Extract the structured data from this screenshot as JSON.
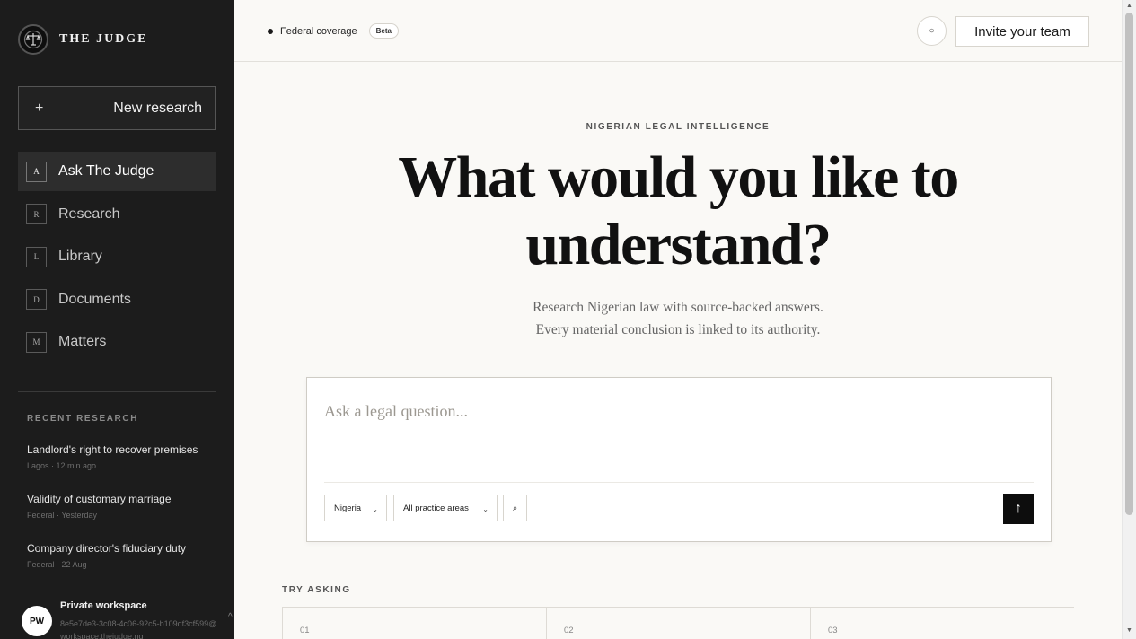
{
  "sidebar": {
    "brand": {
      "name": "THE JUDGE",
      "logo_icon": "scales-of-justice-icon"
    },
    "new_research": {
      "icon": "+",
      "label": "New research"
    },
    "nav": [
      {
        "key": "A",
        "label": "Ask The Judge",
        "active": true
      },
      {
        "key": "R",
        "label": "Research"
      },
      {
        "key": "L",
        "label": "Library"
      },
      {
        "key": "D",
        "label": "Documents"
      },
      {
        "key": "M",
        "label": "Matters"
      }
    ],
    "recent_title": "RECENT RESEARCH",
    "recent": [
      {
        "title": "Landlord's right to recover premises",
        "meta": "Lagos · 12 min ago"
      },
      {
        "title": "Validity of customary marriage",
        "meta": "Federal · Yesterday"
      },
      {
        "title": "Company director's fiduciary duty",
        "meta": "Federal · 22 Aug"
      }
    ],
    "workspace": {
      "initials": "PW",
      "name": "Private workspace",
      "id": "8e5e7de3-3c08-4c06-92c5-b109df3cf599@workspace.thejudge.ng",
      "chevron": "^"
    }
  },
  "topbar": {
    "coverage": "Federal coverage",
    "badge": "Beta",
    "circle_icon": "○",
    "invite_label": "Invite your team"
  },
  "hero": {
    "eyebrow": "NIGERIAN LEGAL INTELLIGENCE",
    "headline": "What would you like to understand?",
    "subline_1": "Research Nigerian law with source-backed answers.",
    "subline_2": "Every material conclusion is linked to its authority."
  },
  "ask": {
    "placeholder": "Ask a legal question...",
    "jurisdiction": "Nigeria",
    "practice_area": "All practice areas",
    "search_icon": "⌕",
    "submit_icon": "↑",
    "caret": "⌄"
  },
  "try_asking": {
    "title": "TRY ASKING",
    "cards": [
      {
        "num": "01"
      },
      {
        "num": "02"
      },
      {
        "num": "03"
      }
    ]
  },
  "colors": {
    "sidebar_bg": "#1c1c1c",
    "main_bg": "#faf9f6",
    "accent": "#0d0d0d"
  }
}
